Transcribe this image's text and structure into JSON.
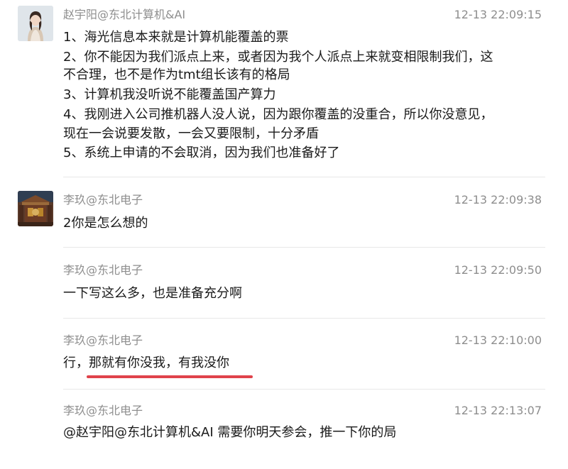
{
  "messages": [
    {
      "sender": "赵宇阳@东北计算机&AI",
      "time": "12-13 22:09:15",
      "avatar": "person-portrait-avatar",
      "lines": [
        "1、海光信息本来就是计算机能覆盖的票",
        "2、你不能因为我们派点上来，或者因为我个人派点上来就变相限制我们，这",
        "不合理，也不是作为tmt组长该有的格局",
        "3、计算机我没听说不能覆盖国产算力",
        "4、我刚进入公司推机器人没人说，因为跟你覆盖的没重合，所以你没意见，",
        "现在一会说要发散，一会又要限制，十分矛盾",
        "5、系统上申请的不会取消，因为我们也准备好了"
      ]
    },
    {
      "sender": "李玖@东北电子",
      "time": "12-13 22:09:38",
      "avatar": "shrine-photo-avatar",
      "lines": [
        "2你是怎么想的"
      ]
    },
    {
      "sender": "李玖@东北电子",
      "time": "12-13 22:09:50",
      "lines": [
        "一下写这么多，也是准备充分啊"
      ]
    },
    {
      "sender": "李玖@东北电子",
      "time": "12-13 22:10:00",
      "lines": [
        "行，那就有你没我，有我没你"
      ],
      "highlight": {
        "color": "#e0434b"
      }
    },
    {
      "sender": "李玖@东北电子",
      "time": "12-13 22:13:07",
      "lines": [
        "@赵宇阳@东北计算机&AI 需要你明天参会，推一下你的局"
      ]
    }
  ]
}
